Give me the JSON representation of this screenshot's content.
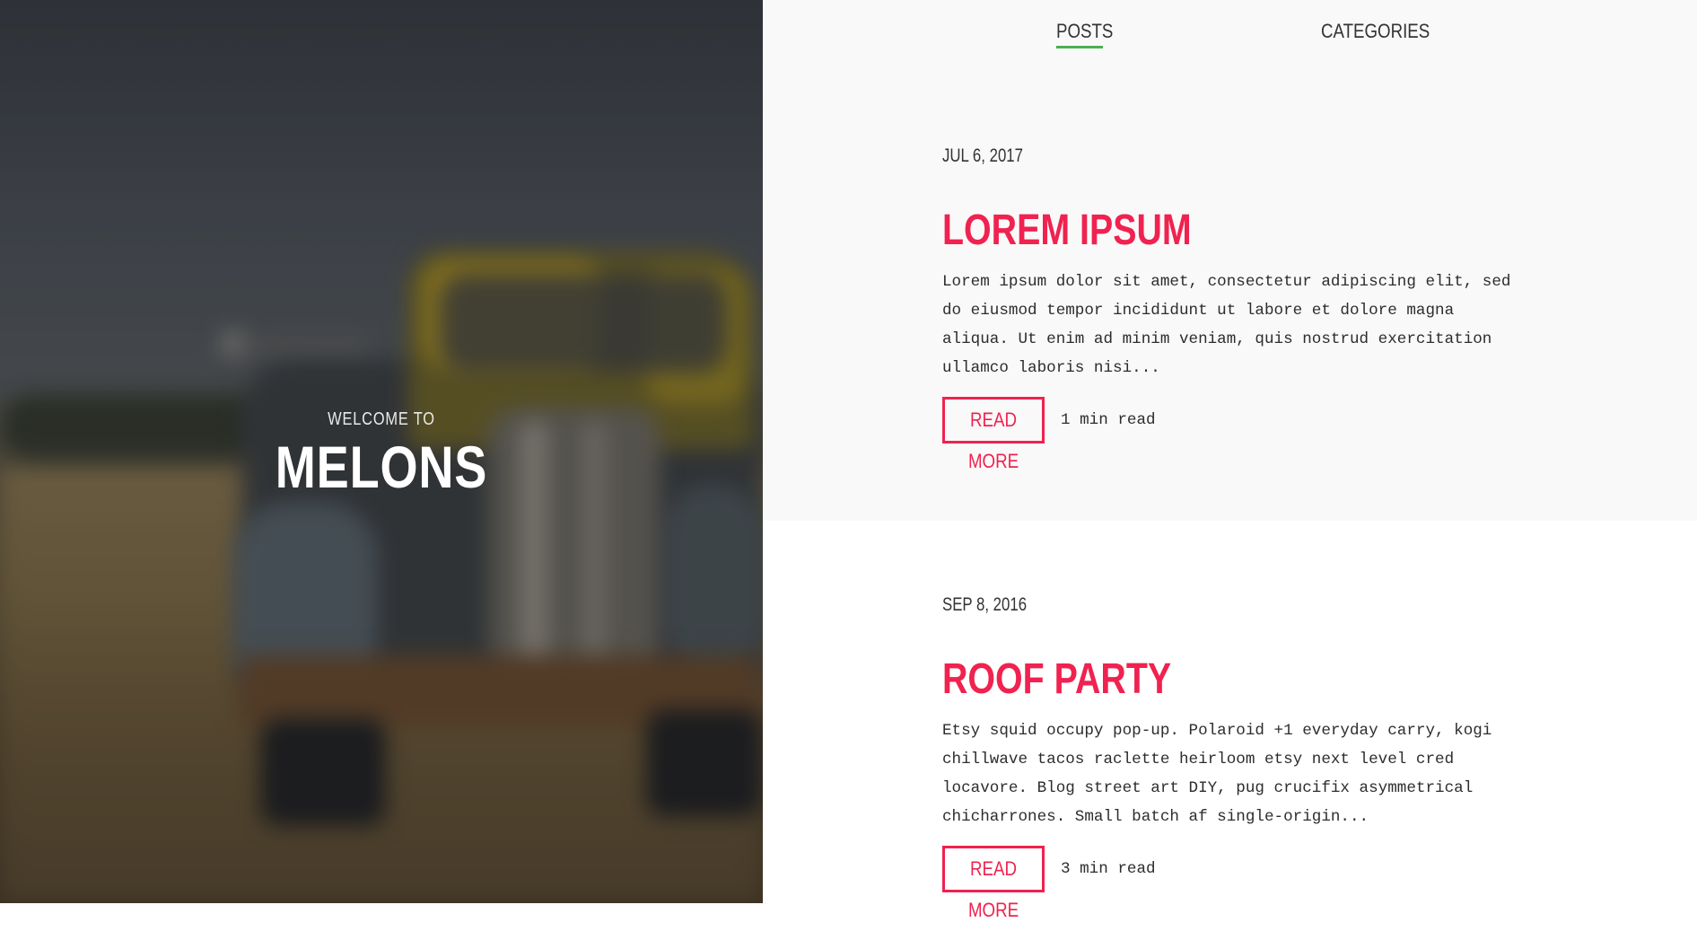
{
  "hero": {
    "welcome": "WELCOME TO",
    "title": "MELONS",
    "image_alt": "blurred photo of a rusty old truck in a field"
  },
  "nav": {
    "items": [
      {
        "label": "POSTS",
        "active": true
      },
      {
        "label": "CATEGORIES",
        "active": false
      }
    ]
  },
  "posts": [
    {
      "date": "JUL 6, 2017",
      "title": "LOREM IPSUM",
      "excerpt": "Lorem ipsum dolor sit amet, consectetur adipiscing elit, sed do eiusmod tempor incididunt ut labore et dolore magna aliqua. Ut enim ad minim veniam, quis nostrud exercitation ullamco laboris nisi...",
      "read_more_label": "READ MORE",
      "read_time": "1 min read"
    },
    {
      "date": "SEP 8, 2016",
      "title": "ROOF PARTY",
      "excerpt": "Etsy squid occupy pop-up. Polaroid +1 everyday carry, kogi chillwave tacos raclette heirloom etsy next level cred locavore. Blog street art DIY, pug crucifix asymmetrical chicharrones. Small batch af single-origin...",
      "read_more_label": "READ MORE",
      "read_time": "3 min read"
    }
  ],
  "colors": {
    "accent": "#f0224f",
    "nav_active_underline": "#4caf50",
    "panel_bg": "#f9f9f9"
  }
}
